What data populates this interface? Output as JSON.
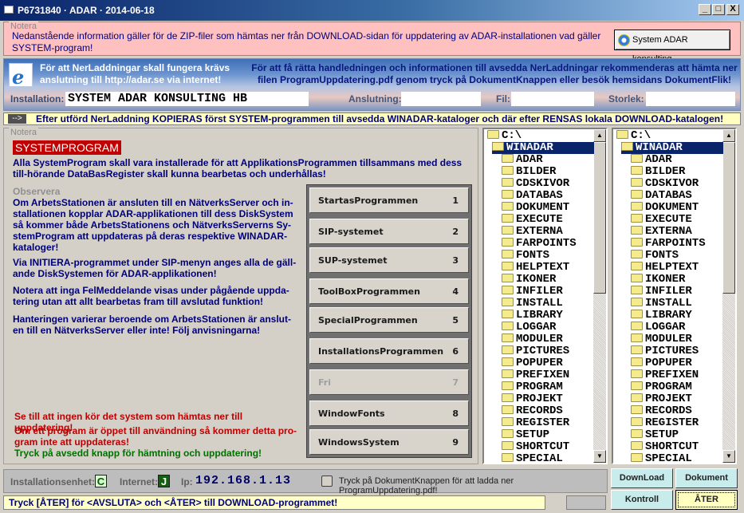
{
  "window": {
    "title": "P6731840 · ADAR · 2014-06-18",
    "controls": {
      "minimize": "_",
      "maximize": "□",
      "close": "X"
    }
  },
  "top_note": {
    "group_label": "Notera",
    "message": "Nedanstående information gäller för de ZIP-filer som hämtas ner från DOWNLOAD-sidan för uppdatering av ADAR-installationen vad gäller SYSTEM-program!",
    "button_label": "System ADAR konsulting",
    "button_icon": "ie-icon"
  },
  "banner": {
    "left_text": "För att NerLaddningar skall fungera krävs anslutning till http://adar.se via internet!",
    "right_text": "För att få rätta handledningen och informationen till avsedda NerLaddningar rekommenderas att hämta ner filen ProgramUppdatering.pdf genom tryck på DokumentKnappen eller besök hemsidans DokumentFlik!",
    "fields": {
      "installation_label": "Installation:",
      "installation_value": "SYSTEM ADAR KONSULTING HB",
      "anslutning_label": "Anslutning:",
      "anslutning_value": "",
      "fil_label": "Fil:",
      "fil_value": "",
      "storlek_label": "Storlek:",
      "storlek_value": ""
    }
  },
  "info_bar": {
    "arrow": "-->",
    "text": "Efter utförd NerLaddning KOPIERAS först SYSTEM-programmen till avsedda WINADAR-kataloger och där efter RENSAS lokala DOWNLOAD-katalogen!"
  },
  "main_note": {
    "group_label": "Notera",
    "heading": "SYSTEMPROGRAM",
    "intro": "Alla SystemProgram skall vara installerade för att ApplikationsProgrammen tillsammans med dess till-hörande DataBasRegister skall kunna bearbetas och underhållas!",
    "observe_label": "Observera",
    "paragraphs": [
      "Om ArbetsStationen är ansluten till en NätverksServer och in-stallationen kopplar ADAR-applikationen till dess DiskSystem så kommer både ArbetsStationens och NätverksServerns Sy-stemProgram att uppdateras på deras respektive WINADAR-kataloger!",
      "Via INITIERA-programmet under SIP-menyn anges alla de gäll-ande DiskSystemen för ADAR-applikationen!",
      "Notera att inga FelMeddelande visas under pågående uppda-tering utan att allt bearbetas fram till avslutad funktion!",
      "Hanteringen varierar beroende om ArbetsStationen är anslut-en till en NätverksServer eller inte! Följ anvisningarna!"
    ],
    "warnings": [
      {
        "text": "Se till att ingen kör det system som hämtas ner till uppdatering!",
        "color": "#c00000"
      },
      {
        "text": "Om ett program är öppet till användning så kommer detta pro-gram inte att uppdateras!",
        "color": "#c00000"
      },
      {
        "text": "Tryck på avsedd knapp för hämtning och uppdatering!",
        "color": "#007000"
      }
    ]
  },
  "program_buttons": [
    {
      "label": "StartasProgrammen",
      "number": "1",
      "enabled": true
    },
    {
      "label": "SIP-systemet",
      "number": "2",
      "enabled": true
    },
    {
      "label": "SUP-systemet",
      "number": "3",
      "enabled": true
    },
    {
      "label": "ToolBoxProgrammen",
      "number": "4",
      "enabled": true
    },
    {
      "label": "SpecialProgrammen",
      "number": "5",
      "enabled": true
    },
    {
      "label": "InstallationsProgrammen",
      "number": "6",
      "enabled": true
    },
    {
      "label": "Fri",
      "number": "7",
      "enabled": false
    },
    {
      "label": "WindowFonts",
      "number": "8",
      "enabled": true
    },
    {
      "label": "WindowsSystem",
      "number": "9",
      "enabled": true
    }
  ],
  "dir_trees": [
    {
      "root": "C:\\",
      "selected": "WINADAR",
      "children": [
        "ADAR",
        "BILDER",
        "CDSKIVOR",
        "DATABAS",
        "DOKUMENT",
        "EXECUTE",
        "EXTERNA",
        "FARPOINTS",
        "FONTS",
        "HELPTEXT",
        "IKONER",
        "INFILER",
        "INSTALL",
        "LIBRARY",
        "LOGGAR",
        "MODULER",
        "PICTURES",
        "POPUPER",
        "PREFIXEN",
        "PROGRAM",
        "PROJEKT",
        "RECORDS",
        "REGISTER",
        "SETUP",
        "SHORTCUT",
        "SPECIAL"
      ]
    },
    {
      "root": "C:\\",
      "selected": "WINADAR",
      "children": [
        "ADAR",
        "BILDER",
        "CDSKIVOR",
        "DATABAS",
        "DOKUMENT",
        "EXECUTE",
        "EXTERNA",
        "FARPOINTS",
        "FONTS",
        "HELPTEXT",
        "IKONER",
        "INFILER",
        "INSTALL",
        "LIBRARY",
        "LOGGAR",
        "MODULER",
        "PICTURES",
        "POPUPER",
        "PREFIXEN",
        "PROGRAM",
        "PROJEKT",
        "RECORDS",
        "REGISTER",
        "SETUP",
        "SHORTCUT",
        "SPECIAL"
      ]
    }
  ],
  "status": {
    "install_unit_label": "Installationsenhet:",
    "install_unit_value": "C",
    "internet_label": "Internet:",
    "internet_value": "J",
    "ip_label": "Ip:",
    "ip_value": "192.168.1.13",
    "checkbox_label": "Tryck på DokumentKnappen för att ladda ner ProgramUppdatering.pdf!",
    "checkbox_checked": false
  },
  "bottom_bar": {
    "text": "Tryck [ÅTER] för <AVSLUTA> och <ÅTER> till DOWNLOAD-programmet!"
  },
  "action_buttons": {
    "download": "DownLoad",
    "dokument": "Dokument",
    "kontroll": "Kontroll",
    "ater": "ÅTER"
  },
  "colors": {
    "title_gradient_start": "#0a246a",
    "note_pink": "#ffc0c0",
    "info_yellow": "#ffffc0",
    "heading_red": "#c00000",
    "text_navy": "#00007a",
    "button_cyan": "#c8ecec"
  }
}
